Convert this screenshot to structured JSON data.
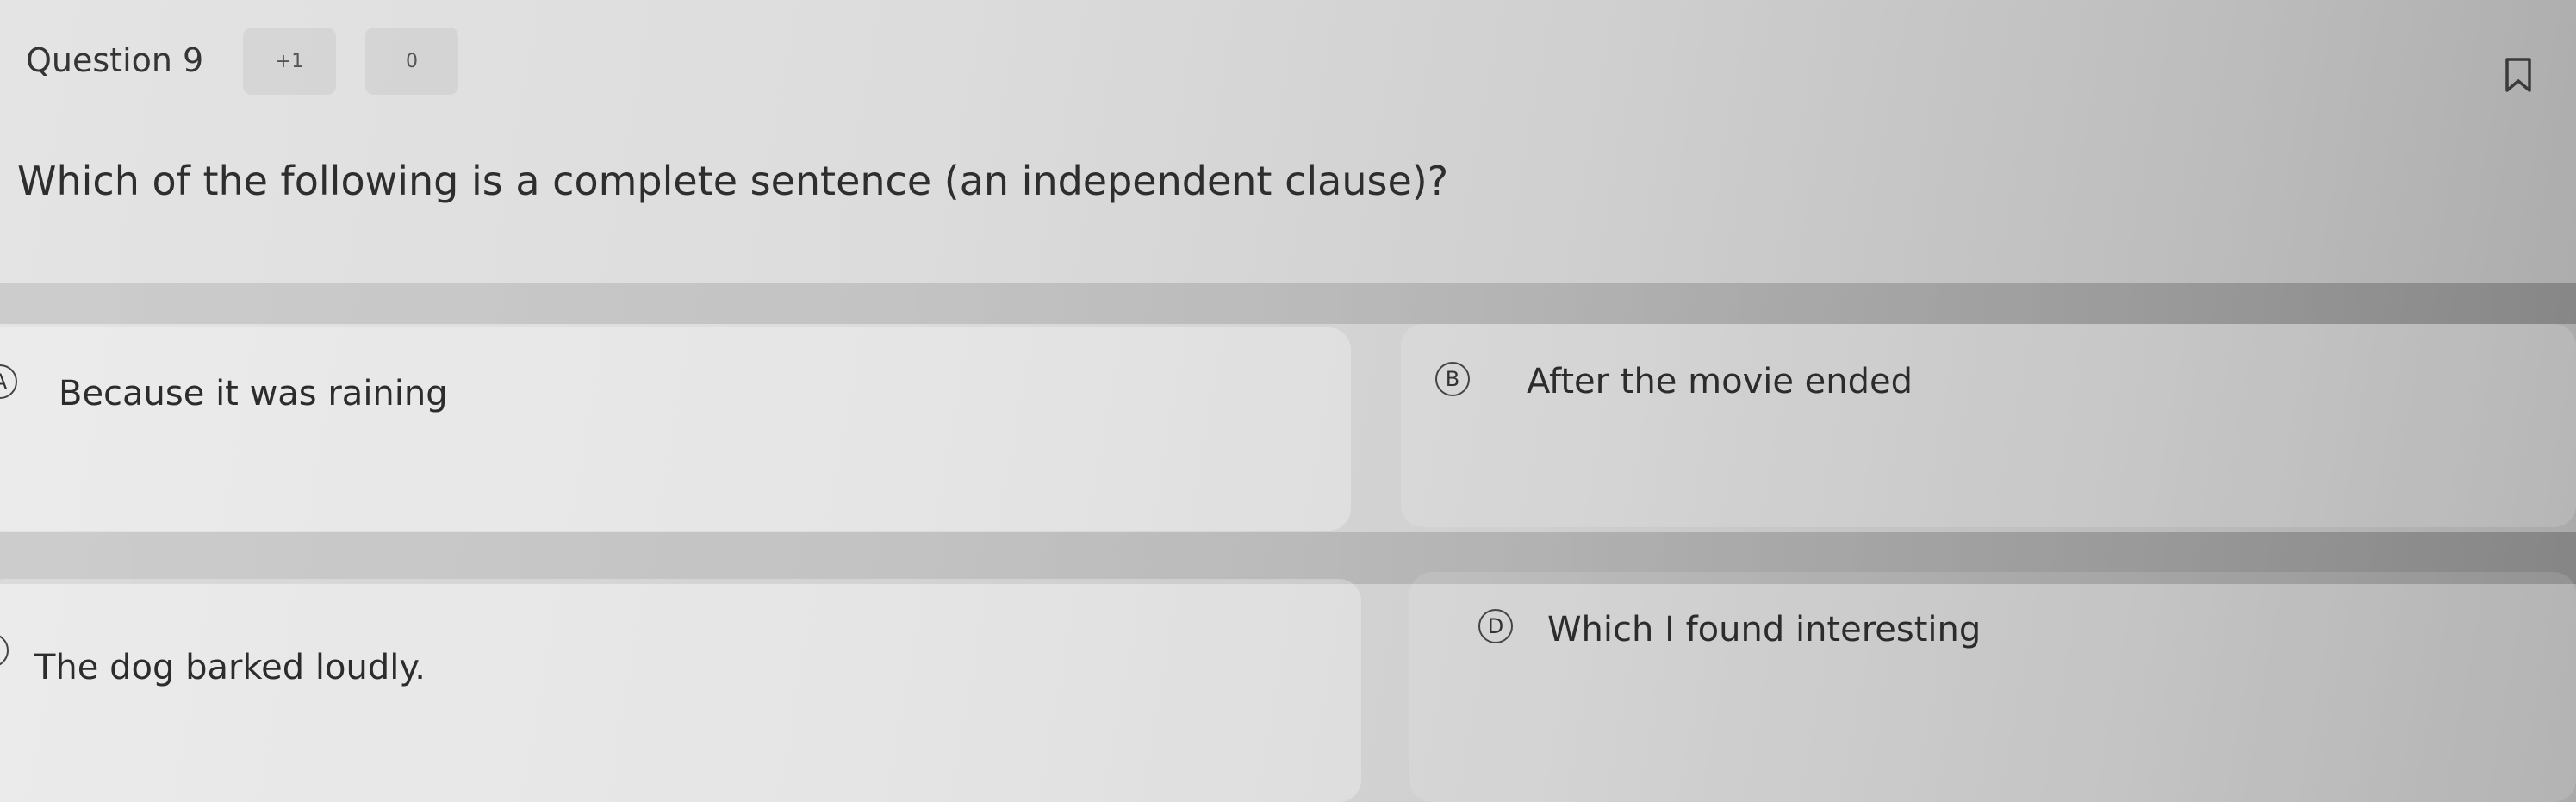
{
  "header": {
    "question_label": "Question 9",
    "points_badge": "+1",
    "zero_badge": "0",
    "bookmark_icon": "bookmark-icon"
  },
  "prompt": "Which of the following is a complete sentence (an independent clause)?",
  "options": [
    {
      "letter": "A",
      "text": "Because it was raining"
    },
    {
      "letter": "B",
      "text": "After the movie ended"
    },
    {
      "letter": "C",
      "text": "The dog barked loudly."
    },
    {
      "letter": "D",
      "text": "Which I found interesting"
    }
  ]
}
